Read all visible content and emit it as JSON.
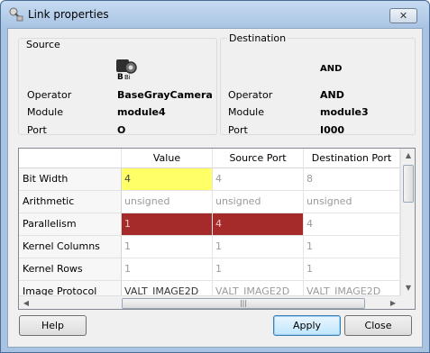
{
  "window": {
    "title": "Link properties",
    "close_glyph": "✕"
  },
  "source": {
    "group_title": "Source",
    "operator_label": "Operator",
    "operator_value": "BaseGrayCamera",
    "module_label": "Module",
    "module_value": "module4",
    "port_label": "Port",
    "port_value": "O",
    "icon": "camera-operator-icon"
  },
  "destination": {
    "group_title": "Destination",
    "header_value": "AND",
    "operator_label": "Operator",
    "operator_value": "AND",
    "module_label": "Module",
    "module_value": "module3",
    "port_label": "Port",
    "port_value": "I000"
  },
  "table": {
    "columns": [
      "Value",
      "Source Port",
      "Destination Port"
    ],
    "rows": [
      {
        "label": "Bit Width",
        "cells": [
          "4",
          "4",
          "8"
        ]
      },
      {
        "label": "Arithmetic",
        "cells": [
          "unsigned",
          "unsigned",
          "unsigned"
        ]
      },
      {
        "label": "Parallelism",
        "cells": [
          "1",
          "4",
          "4"
        ]
      },
      {
        "label": "Kernel Columns",
        "cells": [
          "1",
          "1",
          "1"
        ]
      },
      {
        "label": "Kernel Rows",
        "cells": [
          "1",
          "1",
          "1"
        ]
      },
      {
        "label": "Image Protocol",
        "cells": [
          "VALT_IMAGE2D",
          "VALT_IMAGE2D",
          "VALT_IMAGE2D"
        ]
      }
    ],
    "highlight_colors": {
      "yellow": "#ffff66",
      "red": "#a52a2a"
    }
  },
  "buttons": {
    "help": "Help",
    "apply": "Apply",
    "close": "Close"
  },
  "scrollbar": {
    "grip": "|||"
  }
}
